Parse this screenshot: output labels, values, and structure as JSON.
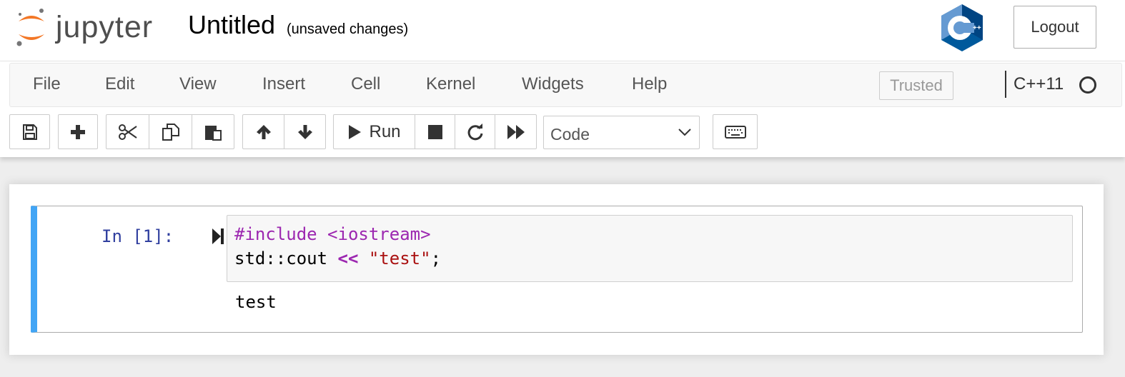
{
  "header": {
    "logo_text": "jupyter",
    "notebook_title": "Untitled",
    "save_status": "(unsaved changes)",
    "kernel_logo_icon": "cpp-kernel-logo",
    "logout_label": "Logout"
  },
  "menubar": {
    "items": [
      {
        "label": "File"
      },
      {
        "label": "Edit"
      },
      {
        "label": "View"
      },
      {
        "label": "Insert"
      },
      {
        "label": "Cell"
      },
      {
        "label": "Kernel"
      },
      {
        "label": "Widgets"
      },
      {
        "label": "Help"
      }
    ],
    "trusted_label": "Trusted",
    "kernel_name": "C++11",
    "kernel_indicator_icon": "kernel-idle-circle-icon"
  },
  "toolbar": {
    "buttons": [
      {
        "icon": "save-icon"
      },
      {
        "icon": "plus-icon"
      },
      {
        "icon": "cut-icon"
      },
      {
        "icon": "copy-icon"
      },
      {
        "icon": "paste-icon"
      },
      {
        "icon": "arrow-up-icon"
      },
      {
        "icon": "arrow-down-icon"
      },
      {
        "icon": "play-icon"
      },
      {
        "icon": "stop-icon"
      },
      {
        "icon": "restart-icon"
      },
      {
        "icon": "fast-forward-icon"
      },
      {
        "icon": "keyboard-icon"
      }
    ],
    "run_label": "Run",
    "cell_type_selected": "Code"
  },
  "notebook": {
    "cells": [
      {
        "prompt": "In [1]:",
        "code_line1_meta": "#include <iostream>",
        "code_line2_a": "std::cout ",
        "code_line2_op": "<<",
        "code_line2_sp": " ",
        "code_line2_str": "\"test\"",
        "code_line2_end": ";",
        "output": "test"
      }
    ]
  },
  "colors": {
    "accent_cell_border": "#42a5f5",
    "prompt_color": "#303f9f",
    "meta_color": "#9c27b0",
    "string_color": "#aa1111",
    "jupyter_orange": "#f37726"
  }
}
